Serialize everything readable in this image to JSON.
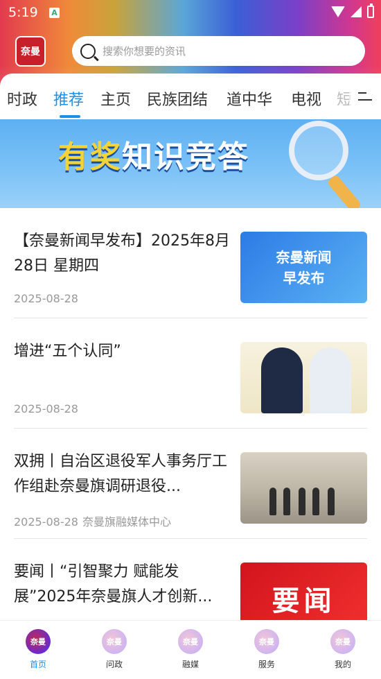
{
  "status": {
    "time": "5:19"
  },
  "header": {
    "logo_text": "奈曼",
    "search_placeholder": "搜索你想要的资讯"
  },
  "tabs": [
    {
      "label": "时政"
    },
    {
      "label": "推荐"
    },
    {
      "label": "主页"
    },
    {
      "label": "民族团结"
    },
    {
      "label": "道中华"
    },
    {
      "label": "电视"
    },
    {
      "label": "短"
    }
  ],
  "banner": {
    "title_gold": "有奖",
    "title_white": "知识竞答"
  },
  "news": [
    {
      "title": "【奈曼新闻早发布】2025年8月28日  星期四",
      "date": "2025-08-28",
      "source": "",
      "thumb_text_1": "奈曼新闻",
      "thumb_text_2": "早发布"
    },
    {
      "title": "增进“五个认同”",
      "date": "2025-08-28",
      "source": ""
    },
    {
      "title": "双拥丨自治区退役军人事务厅工作组赴奈曼旗调研退役...",
      "date": "2025-08-28",
      "source": "奈曼旗融媒体中心"
    },
    {
      "title": "要闻丨“引智聚力  赋能发展”2025年奈曼旗人才创新...",
      "date": "",
      "source": "",
      "thumb_text_1": "要闻"
    }
  ],
  "bottom_nav": [
    {
      "label": "首页",
      "icon": "home-icon"
    },
    {
      "label": "问政",
      "icon": "inquiry-icon"
    },
    {
      "label": "融媒",
      "icon": "media-icon"
    },
    {
      "label": "服务",
      "icon": "service-icon"
    },
    {
      "label": "我的",
      "icon": "profile-icon"
    }
  ],
  "colors": {
    "accent": "#1c8fe6"
  }
}
